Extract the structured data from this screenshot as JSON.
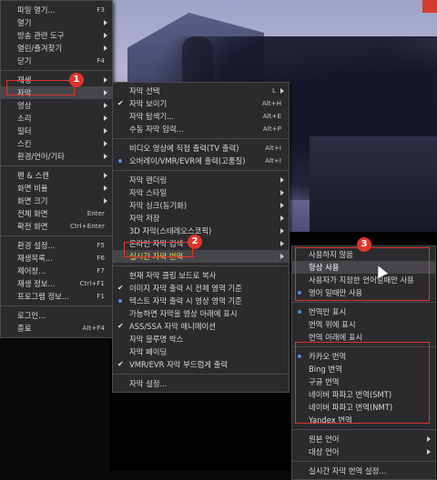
{
  "main_menu": {
    "items": [
      {
        "label": "파일 열기...",
        "shortcut": "F3"
      },
      {
        "label": "열기",
        "arrow": true
      },
      {
        "label": "방송 관련 도구",
        "arrow": true
      },
      {
        "label": "열린/즐겨찾기",
        "arrow": true
      },
      {
        "label": "닫기",
        "shortcut": "F4"
      },
      {
        "sep": true
      },
      {
        "label": "재생",
        "arrow": true
      },
      {
        "label": "자막",
        "arrow": true,
        "highlight": true
      },
      {
        "label": "영상",
        "arrow": true
      },
      {
        "label": "소리",
        "arrow": true
      },
      {
        "label": "필터",
        "arrow": true
      },
      {
        "label": "스킨",
        "arrow": true
      },
      {
        "label": "환경/언어/기타",
        "arrow": true
      },
      {
        "sep": true
      },
      {
        "label": "팬 & 스캔",
        "arrow": true
      },
      {
        "label": "화면 비율",
        "arrow": true
      },
      {
        "label": "화면 크기",
        "arrow": true
      },
      {
        "label": "전체 화면",
        "shortcut": "Enter"
      },
      {
        "label": "확전 화면",
        "shortcut": "Ctrl+Enter"
      },
      {
        "sep": true
      },
      {
        "label": "환경 설정...",
        "shortcut": "F5"
      },
      {
        "label": "재생목록...",
        "shortcut": "F6"
      },
      {
        "label": "제어창...",
        "shortcut": "F7"
      },
      {
        "label": "재생 정보...",
        "shortcut": "Ctrl+F1"
      },
      {
        "label": "프로그램 정보...",
        "shortcut": "F1"
      },
      {
        "sep": true
      },
      {
        "label": "로그인..."
      },
      {
        "label": "종료",
        "shortcut": "Alt+F4"
      }
    ]
  },
  "subtitle_menu": {
    "items": [
      {
        "label": "자막 선택",
        "shortcut": "L",
        "arrow_after": true
      },
      {
        "label": "자막 보이기",
        "shortcut": "Alt+H",
        "check": true
      },
      {
        "label": "자막 탐색기...",
        "shortcut": "Alt+E"
      },
      {
        "label": "수동 자막 입력...",
        "shortcut": "Alt+P"
      },
      {
        "sep": true
      },
      {
        "label": "비디오 영상에 직접 출력(TV 출력)",
        "shortcut": "Alt+I"
      },
      {
        "label": "오버레이/VMR/EVR에 출력(고품질)",
        "shortcut": "Alt+I",
        "dot": "blue"
      },
      {
        "sep": true
      },
      {
        "label": "자막 렌더링",
        "arrow": true
      },
      {
        "label": "자막 스타일",
        "arrow": true
      },
      {
        "label": "자막 싱크(동기화)",
        "arrow": true
      },
      {
        "label": "자막 저장",
        "arrow": true
      },
      {
        "label": "3D 자막(스테레오스코픽)",
        "arrow": true
      },
      {
        "label": "온라인 자막 검색",
        "arrow": true
      },
      {
        "label": "실시간 자막 번역",
        "arrow": true,
        "highlight": true
      },
      {
        "sep": true
      },
      {
        "label": "현재 자막 클립 보드로 복사"
      },
      {
        "label": "이미지 자막 출력 시 전체 영역 기준",
        "check": true
      },
      {
        "label": "텍스트 자막 출력 시 영상 영역 기준",
        "dot": "blue"
      },
      {
        "label": "가능하면 자막을 영상 아래에 표시"
      },
      {
        "label": "ASS/SSA 자막 애니메이션",
        "check": true
      },
      {
        "label": "자막 블루명 박스"
      },
      {
        "label": "자막 페이딩"
      },
      {
        "label": "VMR/EVR 자막 부드럽게 출력",
        "check": true
      },
      {
        "sep": true
      },
      {
        "label": "자막 설정..."
      }
    ]
  },
  "translate_menu": {
    "items": [
      {
        "label": "사용하지 않음"
      },
      {
        "label": "항상 사용",
        "highlight": true
      },
      {
        "label": "사용자가 지정한 언어일때만 사용"
      },
      {
        "label": "영어 일때만 사용",
        "dot": "blue"
      },
      {
        "sep": true
      },
      {
        "label": "번역만 표시",
        "dot": "blue"
      },
      {
        "label": "번역 위에 표시"
      },
      {
        "label": "번역 아래에 표시"
      },
      {
        "sep": true
      },
      {
        "label": "카카오 번역",
        "dot": "blue"
      },
      {
        "label": "Bing 번역"
      },
      {
        "label": "구글 번역"
      },
      {
        "label": "네이버 파파고 번역(SMT)"
      },
      {
        "label": "네이버 파파고 번역(NMT)"
      },
      {
        "label": "Yandex 번역"
      },
      {
        "sep": true
      },
      {
        "label": "원본 언어",
        "arrow": true
      },
      {
        "label": "대상 언어",
        "arrow": true
      },
      {
        "sep": true
      },
      {
        "label": "실시간 자막 번역 설정..."
      }
    ]
  },
  "badges": [
    "1",
    "2",
    "3"
  ],
  "colors": {
    "accent": "#e0342a",
    "menu_bg": "#2b2b2d",
    "highlight": "#46464a",
    "radio_blue": "#4f8fe6"
  }
}
